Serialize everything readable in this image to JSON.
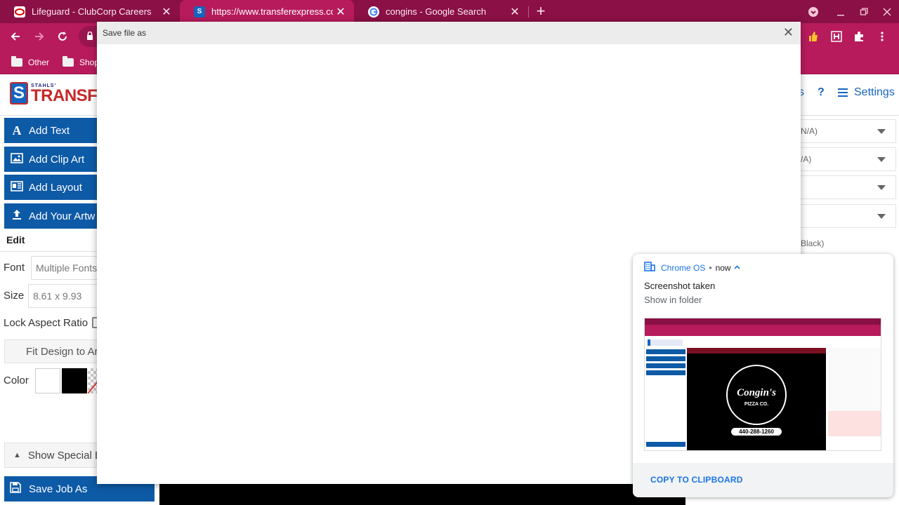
{
  "tabs": [
    {
      "title": "Lifeguard - ClubCorp Careers",
      "active": false
    },
    {
      "title": "https://www.transferexpress.com",
      "active": true
    },
    {
      "title": "congins - Google Search",
      "active": false
    }
  ],
  "tab_close": "✕",
  "new_tab": "+",
  "bookmarks": [
    {
      "label": "Other"
    },
    {
      "label": "Shop"
    }
  ],
  "site": {
    "logo_top": "STAHLS'",
    "logo_name": "TRANSFER E",
    "header_links": {
      "partial": "s",
      "help": "?",
      "settings": "Settings"
    },
    "left_buttons": [
      "Add Text",
      "Add Clip Art",
      "Add Layout",
      "Add Your Artw"
    ],
    "edit_heading": "Edit",
    "font_label": "Font",
    "font_value": "Multiple Fonts",
    "size_label": "Size",
    "size_value": "8.61 x 9.93",
    "aspect_label": "Lock Aspect Ratio",
    "fit_button": "Fit Design to Ar",
    "color_label": "Color",
    "special_button": "Show Special E",
    "save_button": "Save Job As",
    "right_rows": [
      "N/A)",
      "/A)",
      "",
      ""
    ],
    "right_text": "Black)"
  },
  "dialog": {
    "title": "Save file as",
    "close": "✕"
  },
  "notification": {
    "app": "Chrome OS",
    "dot": "•",
    "time": "now",
    "title": "Screenshot taken",
    "subtitle": "Show in folder",
    "action": "COPY TO CLIPBOARD",
    "thumb_phone": "440-288-1260",
    "thumb_brand": "Congin's",
    "thumb_sub": "PIZZA CO."
  },
  "colors": {
    "tabbar": "#8a1046",
    "toolbar": "#b71b5c",
    "site_blue": "#0d5aa7",
    "accent": "#1a73e8"
  }
}
